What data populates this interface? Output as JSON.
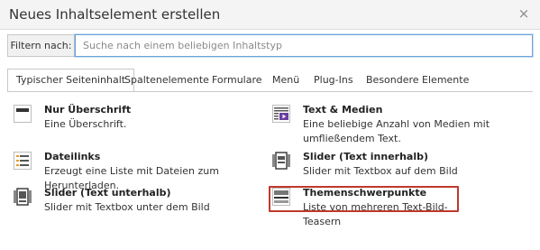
{
  "modal": {
    "title": "Neues Inhaltselement erstellen",
    "close_glyph": "×"
  },
  "filter": {
    "label": "Filtern nach:",
    "placeholder": "Suche nach einem beliebigen Inhaltstyp",
    "value": ""
  },
  "tabs": [
    {
      "label": "Typischer Seiteninhalt",
      "active": true
    },
    {
      "label": "Spaltenelemente",
      "active": false
    },
    {
      "label": "Formulare",
      "active": false
    },
    {
      "label": "Menü",
      "active": false
    },
    {
      "label": "Plug-Ins",
      "active": false
    },
    {
      "label": "Besondere Elemente",
      "active": false
    }
  ],
  "items": [
    {
      "title": "Nur Überschrift",
      "desc": "Eine Überschrift.",
      "icon": "header-icon"
    },
    {
      "title": "Text & Medien",
      "desc": "Eine beliebige Anzahl von Medien mit umfließendem Text.",
      "icon": "textmedia-icon"
    },
    {
      "title": "Dateilinks",
      "desc": "Erzeugt eine Liste mit Dateien zum Herunterladen.",
      "icon": "filelinks-icon"
    },
    {
      "title": "Slider (Text innerhalb)",
      "desc": "Slider mit Textbox auf dem Bild",
      "icon": "slider-icon"
    },
    {
      "title": "Slider (Text unterhalb)",
      "desc": "Slider mit Textbox unter dem Bild",
      "icon": "slider-icon"
    },
    {
      "title": "Themenschwerpunkte",
      "desc": "Liste von mehreren Text-Bild-Teasern",
      "icon": "teaser-icon",
      "highlighted": true
    }
  ],
  "colors": {
    "highlight": "#c0392b",
    "input_border": "#6ba2d9",
    "icon_accent": "#6a3fa0",
    "file_accent": "#e59a2e"
  }
}
